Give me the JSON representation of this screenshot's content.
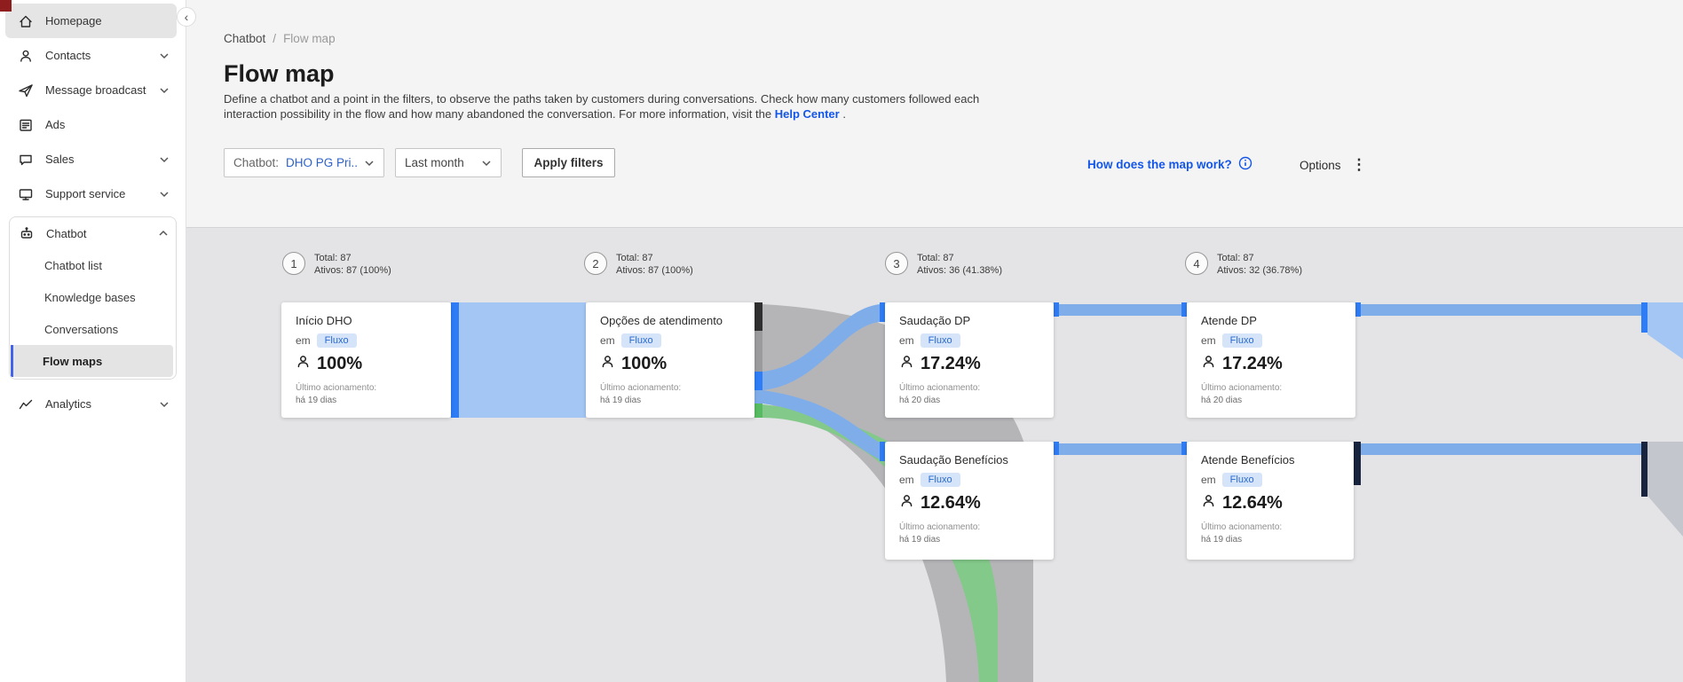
{
  "sidebar": {
    "items": [
      {
        "label": "Homepage"
      },
      {
        "label": "Contacts"
      },
      {
        "label": "Message broadcast"
      },
      {
        "label": "Ads"
      },
      {
        "label": "Sales"
      },
      {
        "label": "Support service"
      }
    ],
    "chatbot": {
      "label": "Chatbot",
      "children": [
        {
          "label": "Chatbot list"
        },
        {
          "label": "Knowledge bases"
        },
        {
          "label": "Conversations"
        },
        {
          "label": "Flow maps"
        }
      ]
    },
    "analytics": {
      "label": "Analytics"
    }
  },
  "breadcrumb": {
    "parent": "Chatbot",
    "separator": "/",
    "current": "Flow map"
  },
  "page": {
    "title": "Flow map",
    "description": "Define a chatbot and a point in the filters, to observe the paths taken by customers during conversations. Check how many customers followed each interaction possibility in the flow and how many abandoned the conversation. For more information, visit the",
    "help_link": "Help Center",
    "period": "."
  },
  "filters": {
    "chatbot_label": "Chatbot:",
    "chatbot_value": "DHO PG Pri...",
    "period_value": "Last month",
    "apply": "Apply filters",
    "how": "How does the map work?",
    "options": "Options"
  },
  "flow": {
    "columns": [
      {
        "number": "1",
        "total": "Total: 87",
        "active": "Ativos: 87 (100%)"
      },
      {
        "number": "2",
        "total": "Total: 87",
        "active": "Ativos: 87 (100%)"
      },
      {
        "number": "3",
        "total": "Total: 87",
        "active": "Ativos: 36 (41.38%)"
      },
      {
        "number": "4",
        "total": "Total: 87",
        "active": "Ativos: 32 (36.78%)"
      }
    ],
    "cards": [
      {
        "title": "Início DHO",
        "em": "em",
        "badge": "Fluxo",
        "percent": "100%",
        "last_label": "Último acionamento:",
        "last_value": "há 19 dias"
      },
      {
        "title": "Opções de atendimento",
        "em": "em",
        "badge": "Fluxo",
        "percent": "100%",
        "last_label": "Último acionamento:",
        "last_value": "há 19 dias"
      },
      {
        "title": "Saudação DP",
        "em": "em",
        "badge": "Fluxo",
        "percent": "17.24%",
        "last_label": "Último acionamento:",
        "last_value": "há 20 dias"
      },
      {
        "title": "Saudação Benefícios",
        "em": "em",
        "badge": "Fluxo",
        "percent": "12.64%",
        "last_label": "Último acionamento:",
        "last_value": "há 19 dias"
      },
      {
        "title": "Atende DP",
        "em": "em",
        "badge": "Fluxo",
        "percent": "17.24%",
        "last_label": "Último acionamento:",
        "last_value": "há 20 dias"
      },
      {
        "title": "Atende Benefícios",
        "em": "em",
        "badge": "Fluxo",
        "percent": "12.64%",
        "last_label": "Último acionamento:",
        "last_value": "há 19 dias"
      }
    ]
  },
  "colors": {
    "accent_blue": "#1356e8",
    "flow_bar_blue": "#2e7cf6",
    "band_light_blue": "#a3c6f4",
    "band_blue": "#7fadea",
    "band_gray": "#b1b1b4",
    "band_green": "#83c98a",
    "band_dark_navy": "#18243e",
    "active_item_bg": "#e5e5e5",
    "active_accent": "#4263eb"
  }
}
